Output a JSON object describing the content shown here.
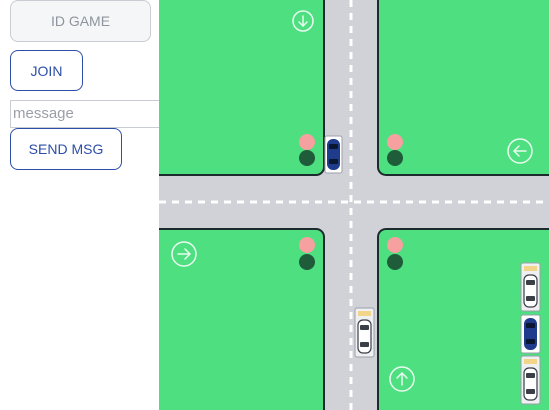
{
  "controls": {
    "id_game_label": "ID GAME",
    "join_label": "JOIN",
    "message_placeholder": "message",
    "send_label": "SEND MSG"
  },
  "board": {
    "colors": {
      "grass": "#4ddf80",
      "road": "#d1d2d7",
      "curb": "#1d2b2c",
      "lane_marking": "#ffffff",
      "light_red": "#f7a0a0",
      "light_green": "#1e5c3a",
      "car_blue": "#1f3c8c",
      "car_white": "#ffffff"
    },
    "direction_icons": [
      "arrow-down-icon",
      "arrow-left-icon",
      "arrow-right-icon",
      "arrow-up-icon"
    ]
  }
}
